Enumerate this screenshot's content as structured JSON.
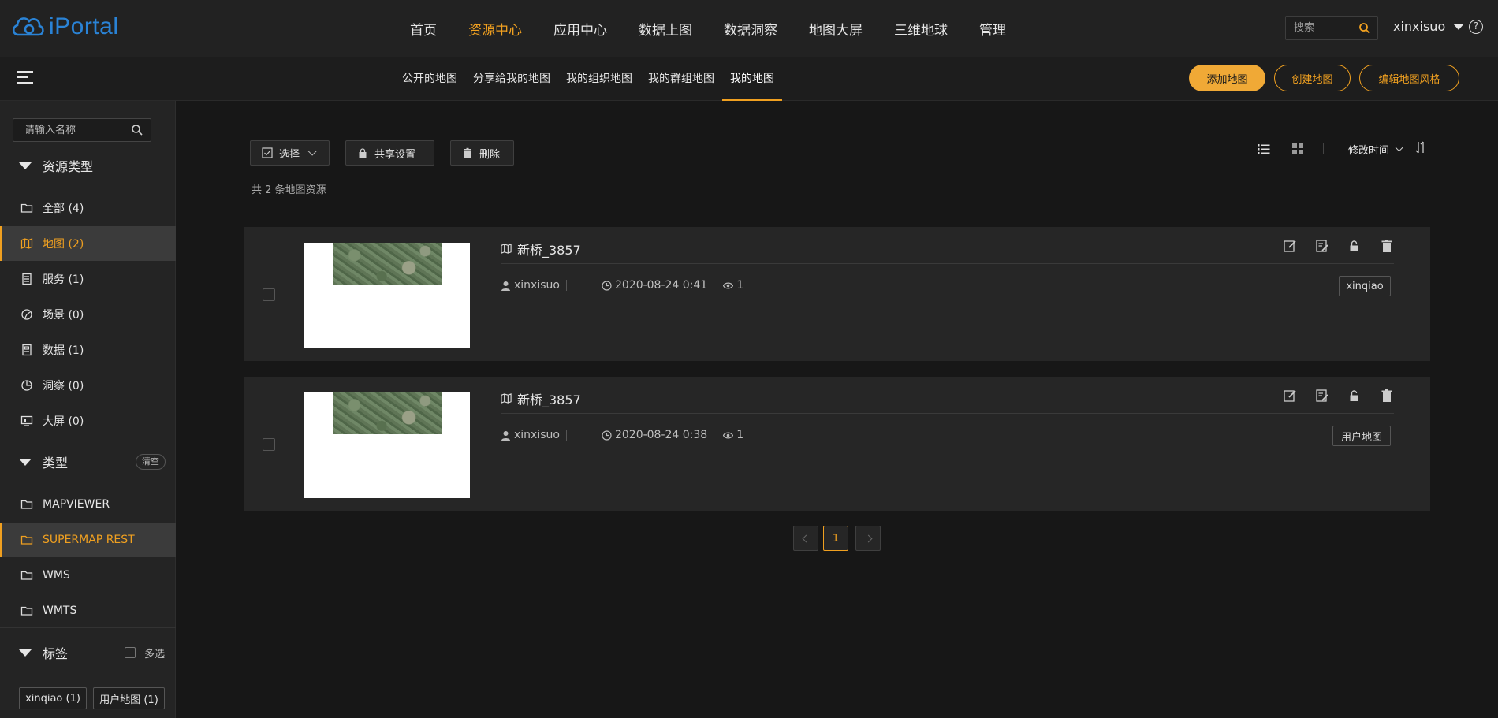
{
  "app": {
    "logo_text": "iPortal",
    "brand_color": "#2a83d6",
    "accent_color": "#f0a020"
  },
  "header": {
    "nav": [
      {
        "label": "首页",
        "active": false
      },
      {
        "label": "资源中心",
        "active": true
      },
      {
        "label": "应用中心",
        "active": false
      },
      {
        "label": "数据上图",
        "active": false
      },
      {
        "label": "数据洞察",
        "active": false
      },
      {
        "label": "地图大屏",
        "active": false
      },
      {
        "label": "三维地球",
        "active": false
      },
      {
        "label": "管理",
        "active": false
      }
    ],
    "search_placeholder": "搜索",
    "user_name": "xinxisuo",
    "help_glyph": "?"
  },
  "subheader": {
    "tabs": [
      {
        "label": "公开的地图",
        "active": false
      },
      {
        "label": "分享给我的地图",
        "active": false
      },
      {
        "label": "我的组织地图",
        "active": false
      },
      {
        "label": "我的群组地图",
        "active": false
      },
      {
        "label": "我的地图",
        "active": true
      }
    ],
    "buttons": {
      "add_map": "添加地图",
      "create_map": "创建地图",
      "edit_style": "编辑地图风格"
    }
  },
  "sidebar": {
    "search_placeholder": "请输入名称",
    "resource_type": {
      "title": "资源类型",
      "items": [
        {
          "label": "全部 (4)",
          "icon": "folder-icon",
          "active": false
        },
        {
          "label": "地图 (2)",
          "icon": "map-icon",
          "active": true
        },
        {
          "label": "服务 (1)",
          "icon": "service-icon",
          "active": false
        },
        {
          "label": "场景 (0)",
          "icon": "scene-icon",
          "active": false
        },
        {
          "label": "数据 (1)",
          "icon": "data-icon",
          "active": false
        },
        {
          "label": "洞察 (0)",
          "icon": "insight-icon",
          "active": false
        },
        {
          "label": "大屏 (0)",
          "icon": "dashboard-icon",
          "active": false
        }
      ]
    },
    "type": {
      "title": "类型",
      "clear_label": "清空",
      "items": [
        {
          "label": "MAPVIEWER",
          "active": false
        },
        {
          "label": "SUPERMAP REST",
          "active": true
        },
        {
          "label": "WMS",
          "active": false
        },
        {
          "label": "WMTS",
          "active": false
        }
      ]
    },
    "tags": {
      "title": "标签",
      "multi_label": "多选",
      "items": [
        {
          "label": "xinqiao (1)"
        },
        {
          "label": "用户地图 (1)"
        }
      ]
    }
  },
  "main": {
    "toolbar": {
      "select_label": "选择",
      "share_label": "共享设置",
      "delete_label": "删除"
    },
    "count_text": "共 2 条地图资源",
    "sort_label": "修改时间",
    "cards": [
      {
        "title": "新桥_3857",
        "owner": "xinxisuo",
        "time": "2020-08-24 0:41",
        "views": "1",
        "tag": "xinqiao"
      },
      {
        "title": "新桥_3857",
        "owner": "xinxisuo",
        "time": "2020-08-24 0:38",
        "views": "1",
        "tag": "用户地图"
      }
    ],
    "pagination": {
      "current_page": "1"
    }
  }
}
